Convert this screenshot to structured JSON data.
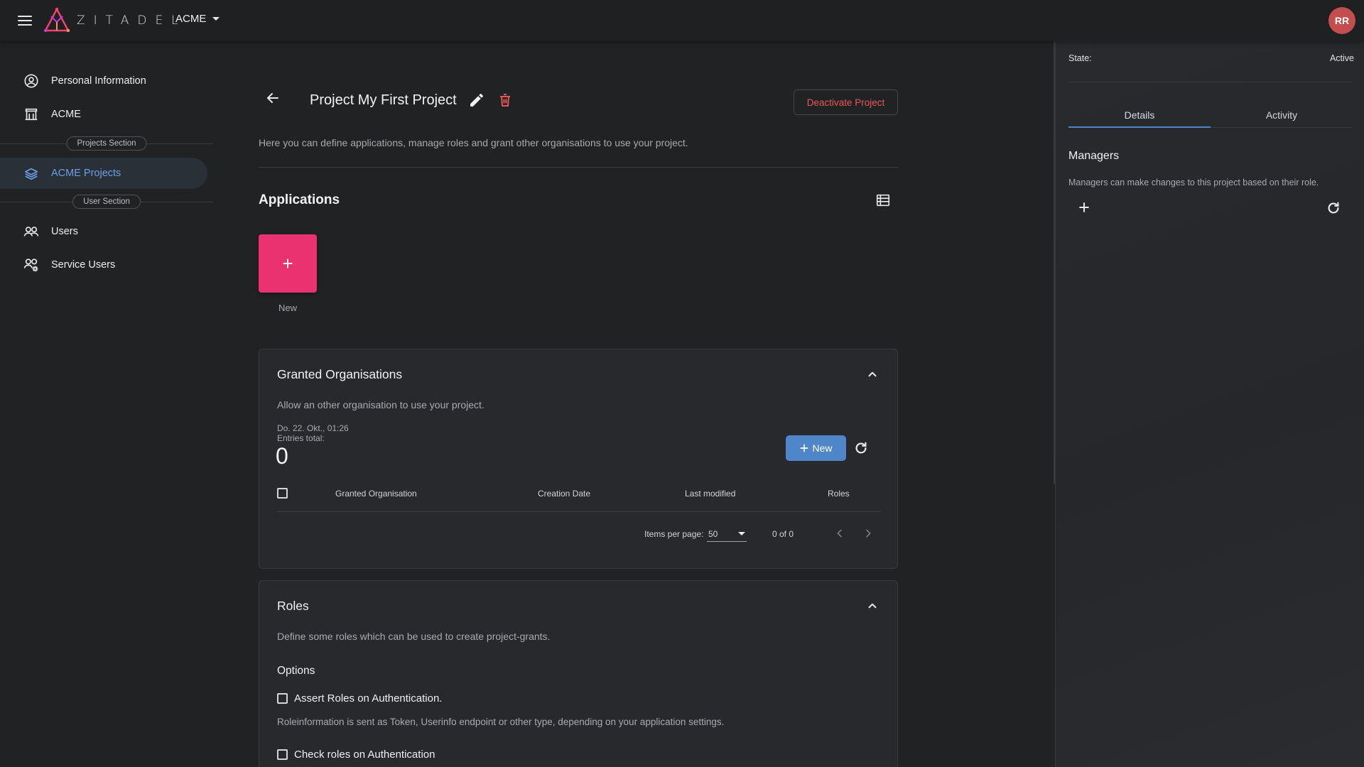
{
  "topbar": {
    "logo_text": "ZITADEL",
    "org_name": "ACME",
    "avatar_initials": "RR"
  },
  "sidebar": {
    "items_top": [
      {
        "label": "Personal Information",
        "icon": "user-circle-icon"
      },
      {
        "label": "ACME",
        "icon": "building-icon"
      }
    ],
    "projects_section_label": "Projects Section",
    "active_item": {
      "label": "ACME Projects",
      "icon": "layers-icon"
    },
    "user_section_label": "User Section",
    "items_bottom": [
      {
        "label": "Users",
        "icon": "users-icon"
      },
      {
        "label": "Service Users",
        "icon": "service-users-icon"
      }
    ]
  },
  "main": {
    "title": "Project My First Project",
    "deactivate_label": "Deactivate Project",
    "description": "Here you can define applications, manage roles and grant other organisations to use your project.",
    "applications": {
      "title": "Applications",
      "new_tile_symbol": "+",
      "new_label": "New"
    },
    "granted": {
      "title": "Granted Organisations",
      "description": "Allow an other organisation to use your project.",
      "timestamp": "Do. 22. Okt., 01:26",
      "entries_label": "Entries total:",
      "entries_count": "0",
      "new_button": "New",
      "columns": [
        "Granted Organisation",
        "Creation Date",
        "Last modified",
        "Roles"
      ],
      "items_per_page_label": "Items per page:",
      "items_per_page": "50",
      "range": "0 of 0"
    },
    "roles": {
      "title": "Roles",
      "description": "Define some roles which can be used to create project-grants.",
      "options_title": "Options",
      "option1_label": "Assert Roles on Authentication.",
      "option1_desc": "Roleinformation is sent as Token, Userinfo endpoint or other type, depending on your application settings.",
      "option2_label": "Check roles on Authentication"
    }
  },
  "right_panel": {
    "state_label": "State:",
    "state_value": "Active",
    "tabs": [
      "Details",
      "Activity"
    ],
    "managers_title": "Managers",
    "managers_desc": "Managers can make changes to this project based on their role."
  },
  "colors": {
    "accent_blue": "#4f86c9",
    "new_tile_pink": "#e9326f",
    "danger_red": "#e85656",
    "avatar_red": "#c44d4d"
  }
}
